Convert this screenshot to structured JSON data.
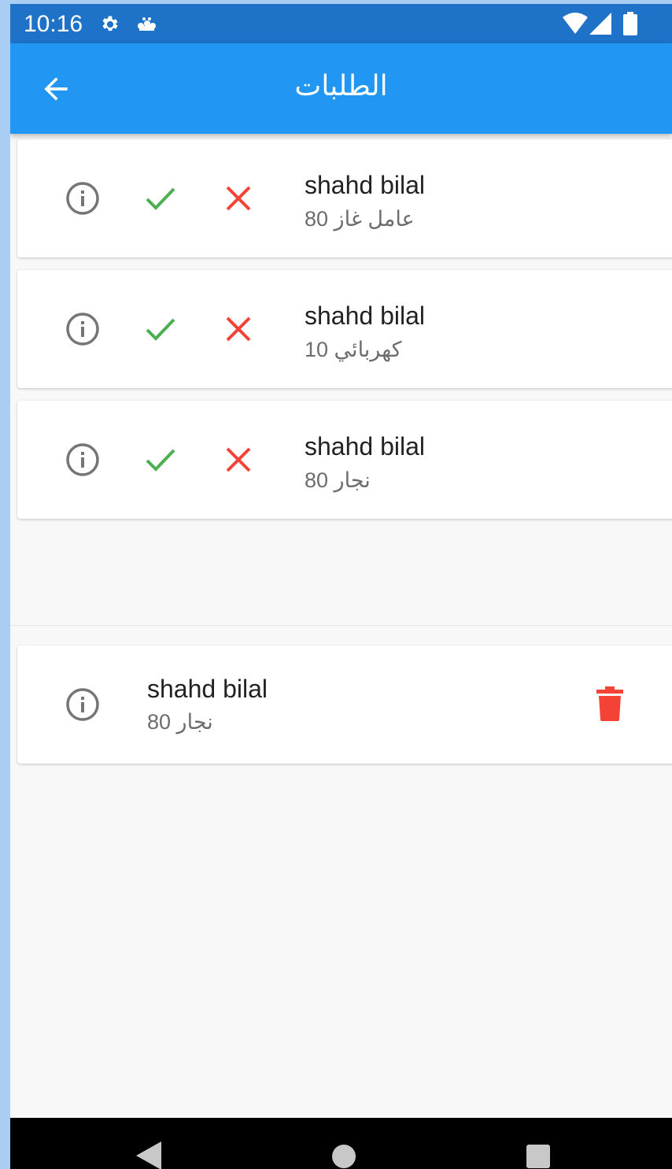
{
  "status_bar": {
    "time": "10:16",
    "icons": [
      "gear-icon",
      "notification-icon",
      "wifi-icon",
      "signal-icon",
      "battery-icon"
    ]
  },
  "app_bar": {
    "title": "الطلبات",
    "back_icon": "arrow-back-icon"
  },
  "requests": [
    {
      "name": "shahd bilal",
      "subtitle": "عامل غاز 80"
    },
    {
      "name": "shahd bilal",
      "subtitle": "كهربائي 10"
    },
    {
      "name": "shahd bilal",
      "subtitle": "نجار 80"
    }
  ],
  "accepted": [
    {
      "name": "shahd bilal",
      "subtitle": "نجار 80"
    }
  ],
  "nav_bar": {
    "icons": [
      "nav-back-icon",
      "nav-home-icon",
      "nav-recents-icon"
    ]
  },
  "colors": {
    "status_bar": "#1e73c8",
    "app_bar": "#2196f3",
    "accept": "#4caf50",
    "reject": "#f44336",
    "delete": "#f44336",
    "info": "#757575",
    "background": "#f8f8f8"
  }
}
